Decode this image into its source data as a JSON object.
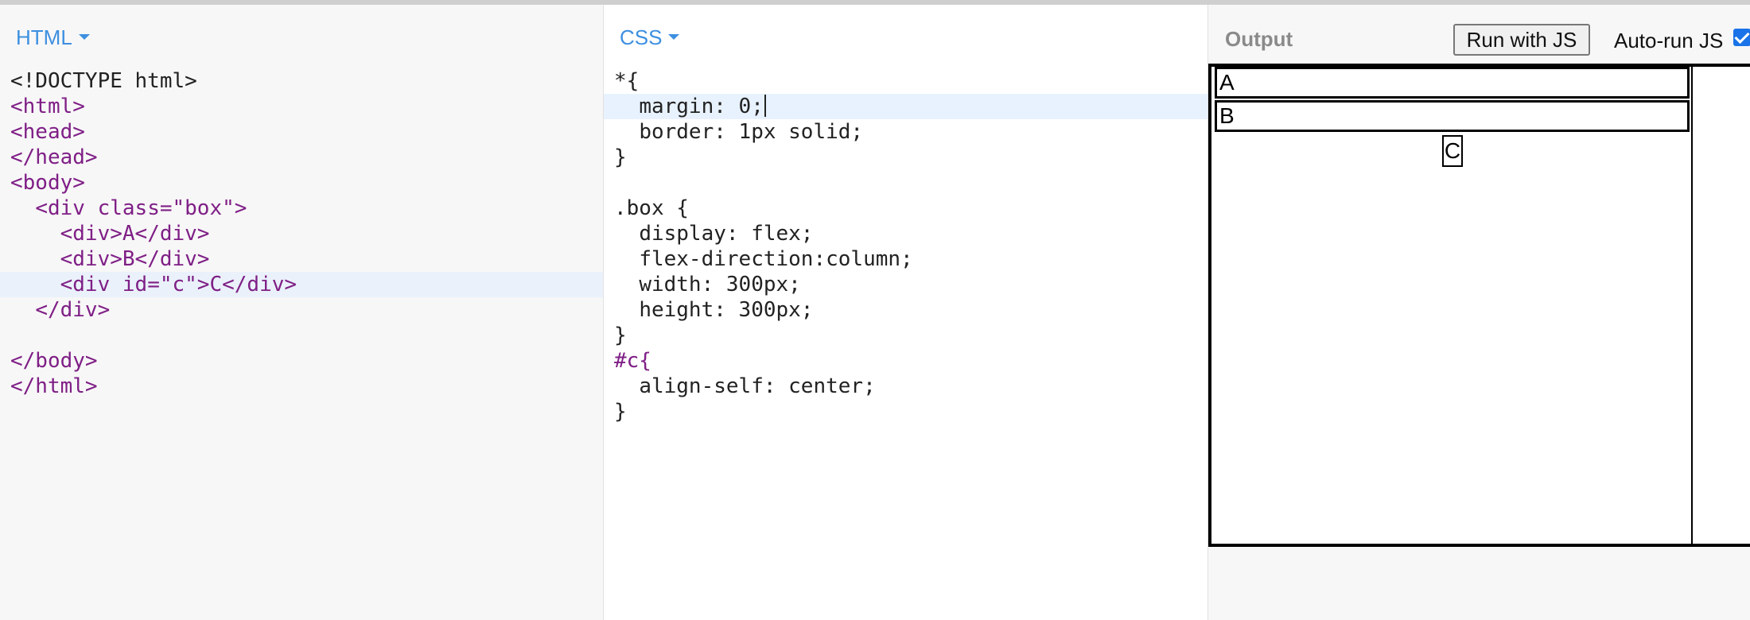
{
  "html_panel": {
    "title": "HTML",
    "lines": [
      "<!DOCTYPE html>",
      "<html>",
      "<head>",
      "</head>",
      "<body>",
      "<div class=\"box\">",
      "<div>A</div>",
      "<div>B</div>",
      "<div id=\"c\">C</div>",
      "</div>",
      "",
      "</body>",
      "</html>"
    ]
  },
  "css_panel": {
    "title": "CSS",
    "lines": [
      "*{",
      "margin: 0;",
      "border: 1px solid;",
      "}",
      "",
      ".box {",
      "display: flex;",
      "flex-direction:column;",
      "width: 300px;",
      "height: 300px;",
      "}",
      "#c{",
      "align-self: center;",
      "}"
    ]
  },
  "output_panel": {
    "title": "Output",
    "run_button": "Run with JS",
    "autorun_label": "Auto-run JS",
    "autorun_checked": true,
    "items": [
      "A",
      "B",
      "C"
    ]
  },
  "colors": {
    "accent": "#3d8fe0",
    "tag": "#7f1f86",
    "attribute": "#9a4d12",
    "string": "#b02a1f",
    "number": "#2e6e3a",
    "keyword": "#1f2a8a",
    "active_line": "#e8f2ff"
  },
  "icons": {
    "dropdown": "caret-down-icon",
    "checkbox": "checkbox-checked-icon"
  }
}
